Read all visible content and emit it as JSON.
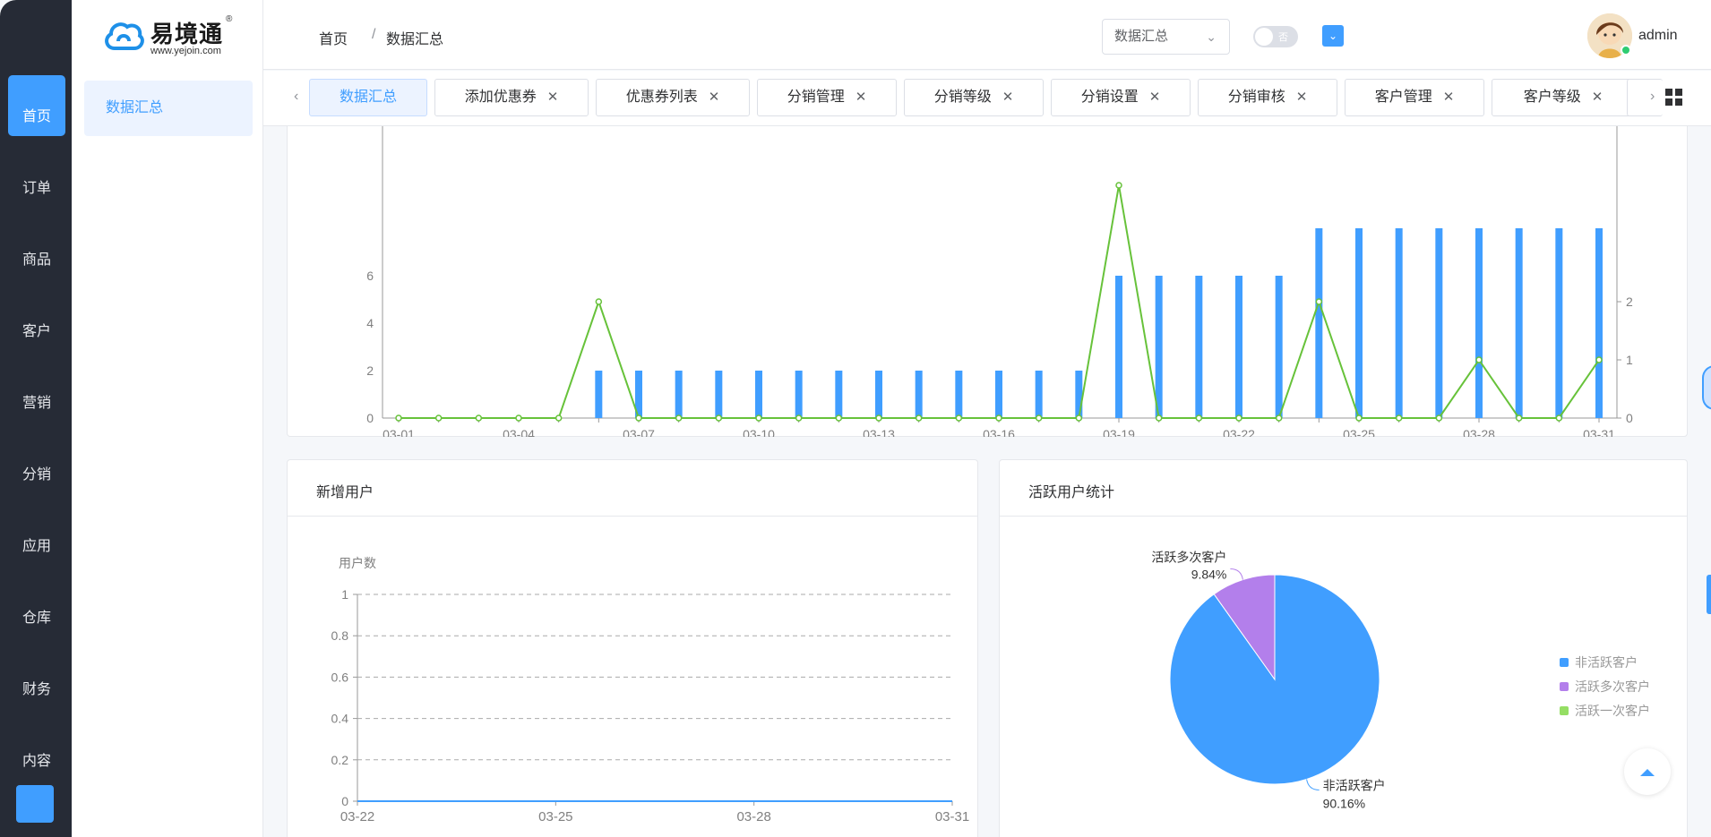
{
  "sidebar": {
    "items": [
      {
        "icon": "home-icon",
        "glyph": "",
        "label": "首页",
        "active": true
      },
      {
        "icon": "order-icon",
        "glyph": "",
        "label": "订单",
        "active": false
      },
      {
        "icon": "goods-icon",
        "glyph": "",
        "label": "商品",
        "active": false
      },
      {
        "icon": "customer-icon",
        "glyph": "",
        "label": "客户",
        "active": false
      },
      {
        "icon": "marketing-icon",
        "glyph": "",
        "label": "营销",
        "active": false
      },
      {
        "icon": "distribution-icon",
        "glyph": "",
        "label": "分销",
        "active": false
      },
      {
        "icon": "app-icon",
        "glyph": "",
        "label": "应用",
        "active": false
      },
      {
        "icon": "warehouse-icon",
        "glyph": "",
        "label": "仓库",
        "active": false
      },
      {
        "icon": "finance-icon",
        "glyph": "",
        "label": "财务",
        "active": false
      },
      {
        "icon": "content-icon",
        "glyph": "",
        "label": "内容",
        "active": false
      }
    ],
    "bottom_glyph": ""
  },
  "logo": {
    "cn": "易境通",
    "en": "www.yejoin.com",
    "reg": "®"
  },
  "subnav": {
    "item_glyph": "",
    "item_label": "数据汇总"
  },
  "breadcrumb": {
    "menu_glyph": "",
    "home_glyph": "",
    "home": "首页",
    "sep": "/",
    "current_glyph": "",
    "current": "数据汇总"
  },
  "header": {
    "search_value": "数据汇总",
    "toggle_label": "否",
    "tool_glyphs": [
      "",
      "",
      "",
      "",
      "",
      "",
      ""
    ],
    "username": "admin",
    "username_suffix": "",
    "accent": "#409eff"
  },
  "tabs": [
    {
      "glyph": "",
      "label": "数据汇总",
      "active": true,
      "closable": false
    },
    {
      "glyph": "",
      "label": "添加优惠券",
      "active": false,
      "closable": true
    },
    {
      "glyph": "",
      "label": "优惠券列表",
      "active": false,
      "closable": true
    },
    {
      "glyph": "",
      "label": "分销管理",
      "active": false,
      "closable": true
    },
    {
      "glyph": "",
      "label": "分销等级",
      "active": false,
      "closable": true
    },
    {
      "glyph": "",
      "label": "分销设置",
      "active": false,
      "closable": true
    },
    {
      "glyph": "",
      "label": "分销审核",
      "active": false,
      "closable": true
    },
    {
      "glyph": "",
      "label": "客户管理",
      "active": false,
      "closable": true
    },
    {
      "glyph": "",
      "label": "客户等级",
      "active": false,
      "closable": true
    }
  ],
  "cards": {
    "new_users": {
      "title": "新增用户"
    },
    "active_users": {
      "title": "活跃用户统计"
    }
  },
  "chart_data": [
    {
      "type": "bar",
      "title": "",
      "x": [
        "03-01",
        "03-02",
        "03-03",
        "03-04",
        "03-05",
        "03-06",
        "03-07",
        "03-08",
        "03-09",
        "03-10",
        "03-11",
        "03-12",
        "03-13",
        "03-14",
        "03-15",
        "03-16",
        "03-17",
        "03-18",
        "03-19",
        "03-20",
        "03-21",
        "03-22",
        "03-23",
        "03-24",
        "03-25",
        "03-26",
        "03-27",
        "03-28",
        "03-29",
        "03-30",
        "03-31"
      ],
      "x_tick_labels": [
        "03-01",
        "03-04",
        "03-07",
        "03-10",
        "03-13",
        "03-16",
        "03-19",
        "03-22",
        "03-25",
        "03-28",
        "03-31"
      ],
      "series": [
        {
          "type": "bar",
          "axis": "left",
          "color": "#409eff",
          "values": [
            0,
            0,
            0,
            0,
            0,
            2,
            2,
            2,
            2,
            2,
            2,
            2,
            2,
            2,
            2,
            2,
            2,
            2,
            6,
            6,
            6,
            6,
            6,
            8,
            8,
            8,
            8,
            8,
            8,
            8,
            8
          ]
        },
        {
          "type": "line",
          "axis": "right",
          "color": "#67c23a",
          "values": [
            0,
            0,
            0,
            0,
            0,
            2,
            0,
            0,
            0,
            0,
            0,
            0,
            0,
            0,
            0,
            0,
            0,
            0,
            4,
            0,
            0,
            0,
            0,
            2,
            0,
            0,
            0,
            1,
            0,
            0,
            1
          ]
        }
      ],
      "y_left_ticks": [
        0,
        2,
        4,
        6
      ],
      "y_right_ticks": [
        0,
        1,
        2
      ],
      "ylim_left": [
        0,
        7
      ],
      "ylim_right": [
        0,
        2.8
      ]
    },
    {
      "type": "line",
      "title": "新增用户",
      "ylabel": "用户数",
      "x": [
        "03-22",
        "03-23",
        "03-24",
        "03-25",
        "03-26",
        "03-27",
        "03-28",
        "03-29",
        "03-30",
        "03-31"
      ],
      "x_tick_labels": [
        "03-22",
        "03-25",
        "03-28",
        "03-31"
      ],
      "series": [
        {
          "color": "#409eff",
          "values": [
            0,
            0,
            0,
            0,
            0,
            0,
            0,
            0,
            0,
            0
          ]
        }
      ],
      "y_ticks": [
        "0",
        "0.2",
        "0.4",
        "0.6",
        "0.8",
        "1"
      ],
      "ylim": [
        0,
        1
      ],
      "grid": true
    },
    {
      "type": "pie",
      "title": "活跃用户统计",
      "slices": [
        {
          "name": "非活跃客户",
          "value": 90.16,
          "label": "90.16%",
          "color": "#409eff"
        },
        {
          "name": "活跃多次客户",
          "value": 9.84,
          "label": "9.84%",
          "color": "#b37feb"
        },
        {
          "name": "活跃一次客户",
          "value": 0,
          "label": "",
          "color": "#95de64"
        }
      ],
      "legend": [
        "非活跃客户",
        "活跃多次客户",
        "活跃一次客户"
      ],
      "legend_position": "right"
    }
  ]
}
